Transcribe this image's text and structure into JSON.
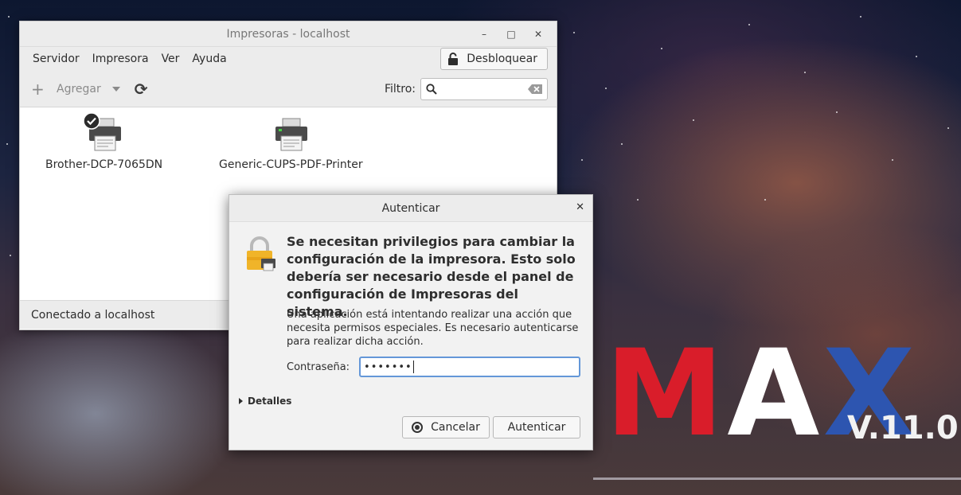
{
  "desktop": {
    "logo": {
      "m": "M",
      "a": "A",
      "x": "X"
    },
    "version": "V.11.0"
  },
  "printers_window": {
    "title": "Impresoras - localhost",
    "controls": {
      "minimize": "–",
      "maximize": "□",
      "close": "✕"
    },
    "menu": [
      "Servidor",
      "Impresora",
      "Ver",
      "Ayuda"
    ],
    "unlock_label": "Desbloquear",
    "toolbar": {
      "add_icon": "+",
      "add_label": "Agregar",
      "refresh_icon": "⟳",
      "filter_label": "Filtro:",
      "filter_value": ""
    },
    "printers": [
      {
        "name": "Brother-DCP-7065DN",
        "default": true
      },
      {
        "name": "Generic-CUPS-PDF-Printer",
        "default": false
      }
    ],
    "status": "Conectado a localhost"
  },
  "auth_dialog": {
    "title": "Autenticar",
    "close": "✕",
    "heading": "Se necesitan privilegios para cambiar la configuración de la impresora. Esto solo debería ser necesario desde el panel de configuración de Impresoras del sistema.",
    "body": "Una aplicación está intentando realizar una acción que necesita permisos especiales. Es necesario autenticarse para realizar dicha acción.",
    "password_label": "Contraseña:",
    "password_value": "•••••••",
    "details_label": "Detalles",
    "cancel_label": "Cancelar",
    "auth_label": "Autenticar"
  },
  "colors": {
    "accent_focus": "#6497d8",
    "logo_m": "#d91d2a",
    "logo_a": "#ffffff",
    "logo_x": "#2d55b0",
    "lock": "#f0b429"
  }
}
